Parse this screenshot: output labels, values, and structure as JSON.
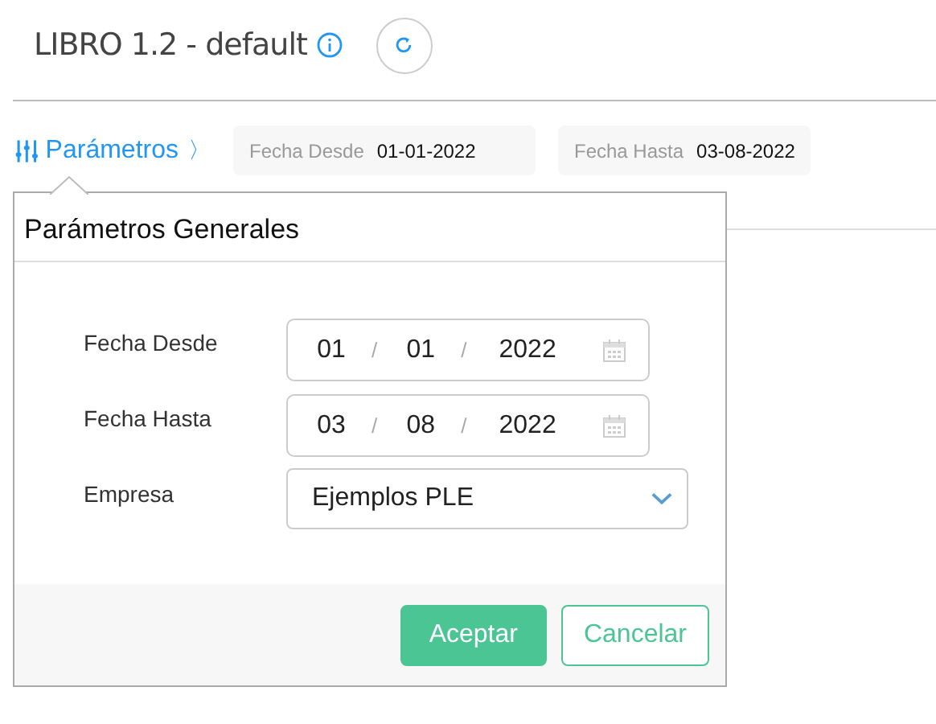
{
  "header": {
    "title": "LIBRO 1.2 - default"
  },
  "filter_bar": {
    "label": "Parámetros",
    "chevron": "〉",
    "chips": [
      {
        "label": "Fecha Desde",
        "value": "01-01-2022"
      },
      {
        "label": "Fecha Hasta",
        "value": "03-08-2022"
      }
    ]
  },
  "popover": {
    "title": "Parámetros Generales",
    "fields": [
      {
        "kind": "date",
        "label": "Fecha Desde",
        "day": "01",
        "month": "01",
        "year": "2022",
        "separator": "/"
      },
      {
        "kind": "date",
        "label": "Fecha Hasta",
        "day": "03",
        "month": "08",
        "year": "2022",
        "separator": "/"
      },
      {
        "kind": "select",
        "label": "Empresa",
        "value": "Ejemplos PLE"
      }
    ],
    "buttons": [
      {
        "label": "Aceptar",
        "kind": "primary"
      },
      {
        "label": "Cancelar",
        "kind": "secondary"
      }
    ]
  }
}
